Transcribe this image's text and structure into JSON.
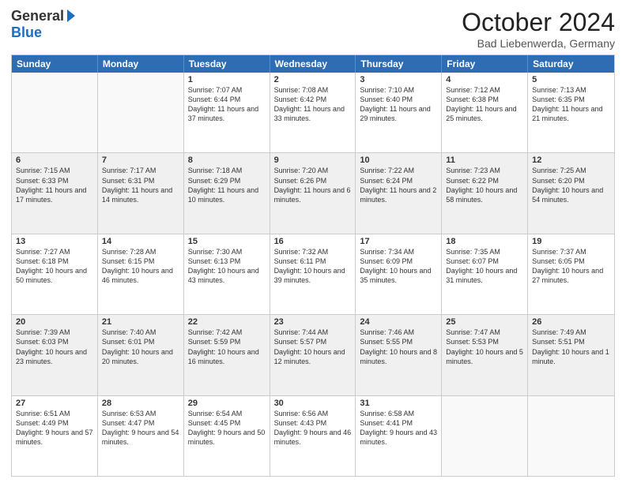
{
  "logo": {
    "general": "General",
    "blue": "Blue"
  },
  "title": "October 2024",
  "location": "Bad Liebenwerda, Germany",
  "days_of_week": [
    "Sunday",
    "Monday",
    "Tuesday",
    "Wednesday",
    "Thursday",
    "Friday",
    "Saturday"
  ],
  "weeks": [
    [
      {
        "day": "",
        "empty": true
      },
      {
        "day": "",
        "empty": true
      },
      {
        "day": "1",
        "sunrise": "Sunrise: 7:07 AM",
        "sunset": "Sunset: 6:44 PM",
        "daylight": "Daylight: 11 hours and 37 minutes."
      },
      {
        "day": "2",
        "sunrise": "Sunrise: 7:08 AM",
        "sunset": "Sunset: 6:42 PM",
        "daylight": "Daylight: 11 hours and 33 minutes."
      },
      {
        "day": "3",
        "sunrise": "Sunrise: 7:10 AM",
        "sunset": "Sunset: 6:40 PM",
        "daylight": "Daylight: 11 hours and 29 minutes."
      },
      {
        "day": "4",
        "sunrise": "Sunrise: 7:12 AM",
        "sunset": "Sunset: 6:38 PM",
        "daylight": "Daylight: 11 hours and 25 minutes."
      },
      {
        "day": "5",
        "sunrise": "Sunrise: 7:13 AM",
        "sunset": "Sunset: 6:35 PM",
        "daylight": "Daylight: 11 hours and 21 minutes."
      }
    ],
    [
      {
        "day": "6",
        "sunrise": "Sunrise: 7:15 AM",
        "sunset": "Sunset: 6:33 PM",
        "daylight": "Daylight: 11 hours and 17 minutes."
      },
      {
        "day": "7",
        "sunrise": "Sunrise: 7:17 AM",
        "sunset": "Sunset: 6:31 PM",
        "daylight": "Daylight: 11 hours and 14 minutes."
      },
      {
        "day": "8",
        "sunrise": "Sunrise: 7:18 AM",
        "sunset": "Sunset: 6:29 PM",
        "daylight": "Daylight: 11 hours and 10 minutes."
      },
      {
        "day": "9",
        "sunrise": "Sunrise: 7:20 AM",
        "sunset": "Sunset: 6:26 PM",
        "daylight": "Daylight: 11 hours and 6 minutes."
      },
      {
        "day": "10",
        "sunrise": "Sunrise: 7:22 AM",
        "sunset": "Sunset: 6:24 PM",
        "daylight": "Daylight: 11 hours and 2 minutes."
      },
      {
        "day": "11",
        "sunrise": "Sunrise: 7:23 AM",
        "sunset": "Sunset: 6:22 PM",
        "daylight": "Daylight: 10 hours and 58 minutes."
      },
      {
        "day": "12",
        "sunrise": "Sunrise: 7:25 AM",
        "sunset": "Sunset: 6:20 PM",
        "daylight": "Daylight: 10 hours and 54 minutes."
      }
    ],
    [
      {
        "day": "13",
        "sunrise": "Sunrise: 7:27 AM",
        "sunset": "Sunset: 6:18 PM",
        "daylight": "Daylight: 10 hours and 50 minutes."
      },
      {
        "day": "14",
        "sunrise": "Sunrise: 7:28 AM",
        "sunset": "Sunset: 6:15 PM",
        "daylight": "Daylight: 10 hours and 46 minutes."
      },
      {
        "day": "15",
        "sunrise": "Sunrise: 7:30 AM",
        "sunset": "Sunset: 6:13 PM",
        "daylight": "Daylight: 10 hours and 43 minutes."
      },
      {
        "day": "16",
        "sunrise": "Sunrise: 7:32 AM",
        "sunset": "Sunset: 6:11 PM",
        "daylight": "Daylight: 10 hours and 39 minutes."
      },
      {
        "day": "17",
        "sunrise": "Sunrise: 7:34 AM",
        "sunset": "Sunset: 6:09 PM",
        "daylight": "Daylight: 10 hours and 35 minutes."
      },
      {
        "day": "18",
        "sunrise": "Sunrise: 7:35 AM",
        "sunset": "Sunset: 6:07 PM",
        "daylight": "Daylight: 10 hours and 31 minutes."
      },
      {
        "day": "19",
        "sunrise": "Sunrise: 7:37 AM",
        "sunset": "Sunset: 6:05 PM",
        "daylight": "Daylight: 10 hours and 27 minutes."
      }
    ],
    [
      {
        "day": "20",
        "sunrise": "Sunrise: 7:39 AM",
        "sunset": "Sunset: 6:03 PM",
        "daylight": "Daylight: 10 hours and 23 minutes."
      },
      {
        "day": "21",
        "sunrise": "Sunrise: 7:40 AM",
        "sunset": "Sunset: 6:01 PM",
        "daylight": "Daylight: 10 hours and 20 minutes."
      },
      {
        "day": "22",
        "sunrise": "Sunrise: 7:42 AM",
        "sunset": "Sunset: 5:59 PM",
        "daylight": "Daylight: 10 hours and 16 minutes."
      },
      {
        "day": "23",
        "sunrise": "Sunrise: 7:44 AM",
        "sunset": "Sunset: 5:57 PM",
        "daylight": "Daylight: 10 hours and 12 minutes."
      },
      {
        "day": "24",
        "sunrise": "Sunrise: 7:46 AM",
        "sunset": "Sunset: 5:55 PM",
        "daylight": "Daylight: 10 hours and 8 minutes."
      },
      {
        "day": "25",
        "sunrise": "Sunrise: 7:47 AM",
        "sunset": "Sunset: 5:53 PM",
        "daylight": "Daylight: 10 hours and 5 minutes."
      },
      {
        "day": "26",
        "sunrise": "Sunrise: 7:49 AM",
        "sunset": "Sunset: 5:51 PM",
        "daylight": "Daylight: 10 hours and 1 minute."
      }
    ],
    [
      {
        "day": "27",
        "sunrise": "Sunrise: 6:51 AM",
        "sunset": "Sunset: 4:49 PM",
        "daylight": "Daylight: 9 hours and 57 minutes."
      },
      {
        "day": "28",
        "sunrise": "Sunrise: 6:53 AM",
        "sunset": "Sunset: 4:47 PM",
        "daylight": "Daylight: 9 hours and 54 minutes."
      },
      {
        "day": "29",
        "sunrise": "Sunrise: 6:54 AM",
        "sunset": "Sunset: 4:45 PM",
        "daylight": "Daylight: 9 hours and 50 minutes."
      },
      {
        "day": "30",
        "sunrise": "Sunrise: 6:56 AM",
        "sunset": "Sunset: 4:43 PM",
        "daylight": "Daylight: 9 hours and 46 minutes."
      },
      {
        "day": "31",
        "sunrise": "Sunrise: 6:58 AM",
        "sunset": "Sunset: 4:41 PM",
        "daylight": "Daylight: 9 hours and 43 minutes."
      },
      {
        "day": "",
        "empty": true
      },
      {
        "day": "",
        "empty": true
      }
    ]
  ]
}
